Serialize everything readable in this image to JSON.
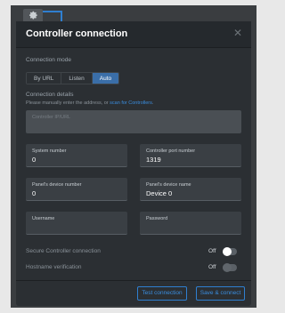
{
  "modal": {
    "title": "Controller connection",
    "close_glyph": "✕"
  },
  "connection_mode": {
    "label": "Connection mode",
    "options": [
      "By URL",
      "Listen",
      "Auto"
    ],
    "selected": "Auto"
  },
  "connection_details": {
    "label": "Connection details",
    "hint_prefix": "Please manually enter the address, or ",
    "hint_link": "scan for Controllers",
    "hint_suffix": ".",
    "address_placeholder": "Controller IP/URL"
  },
  "fields": {
    "system_number": {
      "label": "System number",
      "value": "0"
    },
    "controller_port": {
      "label": "Controller port number",
      "value": "1319"
    },
    "panel_device_number": {
      "label": "Panel's device number",
      "value": "0"
    },
    "panel_device_name": {
      "label": "Panel's device name",
      "value": "Device 0"
    },
    "username": {
      "label": "Username",
      "value": ""
    },
    "password": {
      "label": "Password",
      "value": ""
    }
  },
  "toggles": {
    "secure": {
      "label": "Secure Controller connection",
      "state": "Off"
    },
    "hostname": {
      "label": "Hostname verification",
      "state": "Off"
    }
  },
  "footer": {
    "test_label": "Test connection",
    "save_label": "Save & connect"
  },
  "icons": {
    "settings_tab": "gear-icon"
  },
  "colors": {
    "accent": "#2f7fd0",
    "modal_bg": "#2b2f33"
  }
}
